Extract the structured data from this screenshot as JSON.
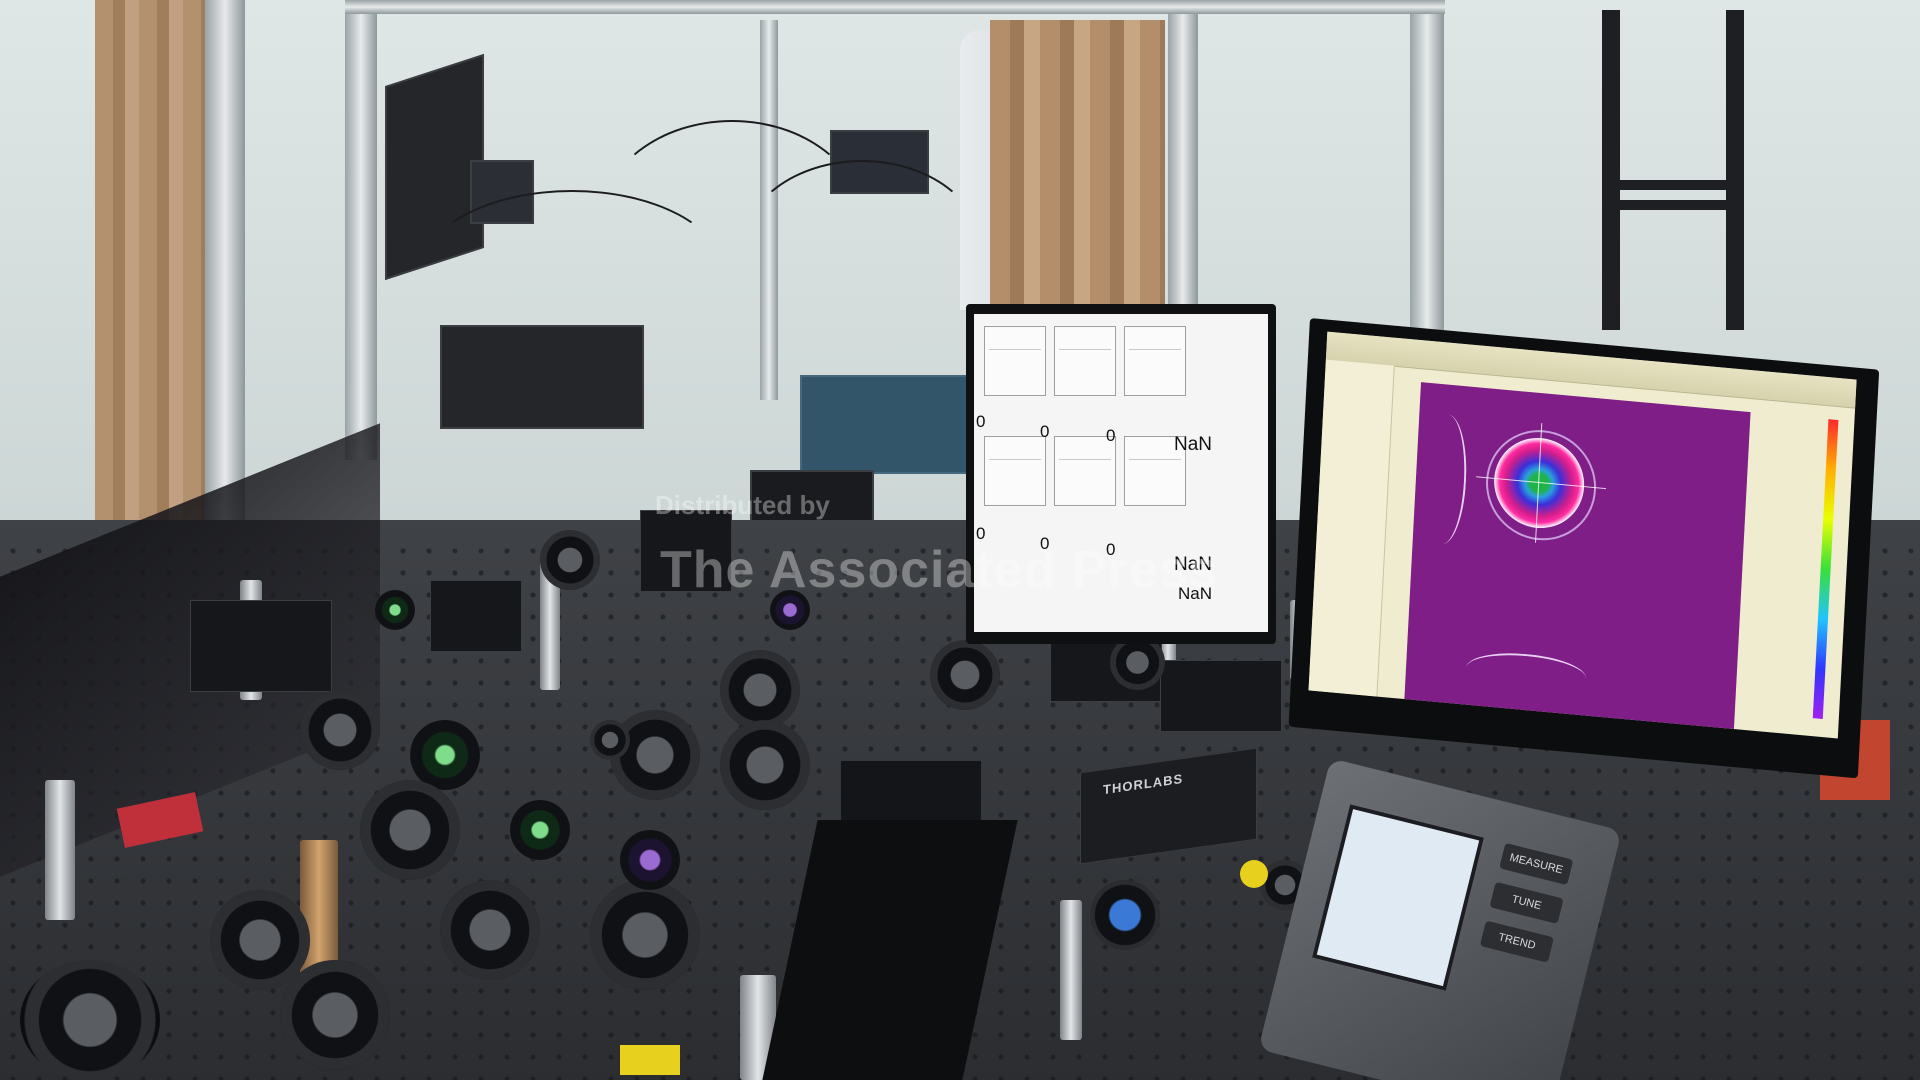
{
  "scene": {
    "left_monitor": {
      "readouts": [
        {
          "value": "0"
        },
        {
          "value": "0"
        },
        {
          "value": "0"
        },
        {
          "value": "NaN"
        },
        {
          "value": "0"
        },
        {
          "value": "0"
        },
        {
          "value": "0"
        },
        {
          "value": "NaN"
        },
        {
          "value": "NaN"
        }
      ]
    },
    "instrument_labels": {
      "thorlabs": "THORLABS",
      "pm_btn_1": "MEASURE",
      "pm_btn_2": "TUNE",
      "pm_btn_3": "TREND"
    },
    "watermark": {
      "line1": "Distributed by",
      "line2": "The Associated Press"
    },
    "colors": {
      "beam_background": "#7e1e86",
      "app_background": "#efeccf",
      "optical_table": "#2b2d31"
    }
  }
}
